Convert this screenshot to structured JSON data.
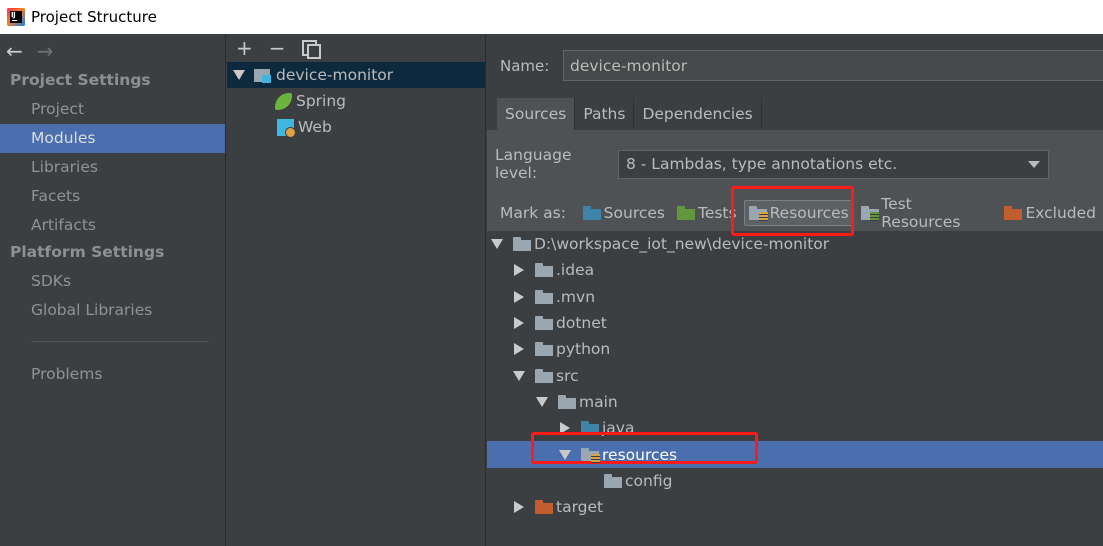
{
  "window": {
    "title": "Project Structure"
  },
  "nav": {
    "back": "←",
    "forward": "→",
    "project_settings": {
      "title": "Project Settings",
      "items": [
        {
          "label": "Project",
          "selected": false
        },
        {
          "label": "Modules",
          "selected": true
        },
        {
          "label": "Libraries",
          "selected": false
        },
        {
          "label": "Facets",
          "selected": false
        },
        {
          "label": "Artifacts",
          "selected": false
        }
      ]
    },
    "platform_settings": {
      "title": "Platform Settings",
      "items": [
        {
          "label": "SDKs"
        },
        {
          "label": "Global Libraries"
        }
      ]
    },
    "problems": "Problems"
  },
  "modules": {
    "toolbar": {
      "add": "+",
      "remove": "−"
    },
    "tree": [
      {
        "label": "device-monitor",
        "icon": "module-icon",
        "selected": true
      },
      {
        "label": "Spring",
        "icon": "spring-icon"
      },
      {
        "label": "Web",
        "icon": "web-icon"
      }
    ]
  },
  "details": {
    "name_label": "Name:",
    "name_value": "device-monitor",
    "tabs": [
      {
        "label": "Sources",
        "active": true
      },
      {
        "label": "Paths",
        "active": false
      },
      {
        "label": "Dependencies",
        "active": false
      }
    ],
    "language_level_label": "Language level:",
    "language_level_value": "8 - Lambdas, type annotations etc.",
    "mark_as_label": "Mark as:",
    "mark_buttons": [
      {
        "label": "Sources",
        "icon": "source-folder-icon",
        "color": "#3d84a8"
      },
      {
        "label": "Tests",
        "icon": "test-folder-icon",
        "color": "#62973e"
      },
      {
        "label": "Resources",
        "icon": "resources-folder-icon",
        "color": "#d9a343",
        "pressed": true
      },
      {
        "label": "Test Resources",
        "icon": "test-resources-folder-icon",
        "color": "#62973e"
      },
      {
        "label": "Excluded",
        "icon": "excluded-folder-icon",
        "color": "#c25d2e"
      }
    ],
    "content_tree": [
      {
        "label": "D:\\workspace_iot_new\\device-monitor",
        "expanded": true,
        "icon": "folder-icon"
      },
      {
        "label": ".idea",
        "expanded": false,
        "icon": "folder-icon"
      },
      {
        "label": ".mvn",
        "expanded": false,
        "icon": "folder-icon"
      },
      {
        "label": "dotnet",
        "expanded": false,
        "icon": "folder-icon"
      },
      {
        "label": "python",
        "expanded": false,
        "icon": "folder-icon"
      },
      {
        "label": "src",
        "expanded": true,
        "icon": "folder-icon"
      },
      {
        "label": "main",
        "expanded": true,
        "icon": "folder-icon"
      },
      {
        "label": "java",
        "expanded": false,
        "icon": "source-folder-icon"
      },
      {
        "label": "resources",
        "expanded": true,
        "icon": "resources-folder-icon",
        "selected": true
      },
      {
        "label": "config",
        "icon": "folder-icon"
      },
      {
        "label": "target",
        "expanded": false,
        "icon": "excluded-folder-icon"
      }
    ]
  },
  "colors": {
    "selection": "#4b6eaf",
    "highlight_box": "#ff1a1a"
  }
}
